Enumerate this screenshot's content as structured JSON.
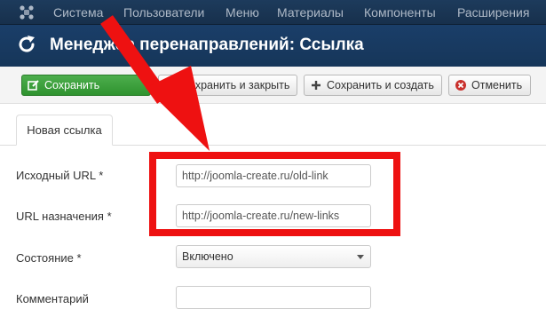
{
  "menubar": {
    "items": [
      "Система",
      "Пользователи",
      "Меню",
      "Материалы",
      "Компоненты",
      "Расширения"
    ]
  },
  "header": {
    "title": "Менеджер перенаправлений: Ссылка"
  },
  "toolbar": {
    "save_label": "Сохранить",
    "save_close_label": "Сохранить и закрыть",
    "save_new_label": "Сохранить и создать",
    "cancel_label": "Отменить"
  },
  "tabs": [
    {
      "label": "Новая ссылка"
    }
  ],
  "form": {
    "source_url_label": "Исходный URL *",
    "source_url_value": "http://joomla-create.ru/old-link",
    "dest_url_label": "URL назначения *",
    "dest_url_value": "http://joomla-create.ru/new-links",
    "status_label": "Состояние *",
    "status_value": "Включено",
    "comment_label": "Комментарий",
    "comment_value": ""
  },
  "colors": {
    "menubar_bg": "#1d3b5c",
    "titlebar_bg": "#1a3e69",
    "primary_button": "#3aa13a",
    "annotation_red": "#ee1111"
  }
}
